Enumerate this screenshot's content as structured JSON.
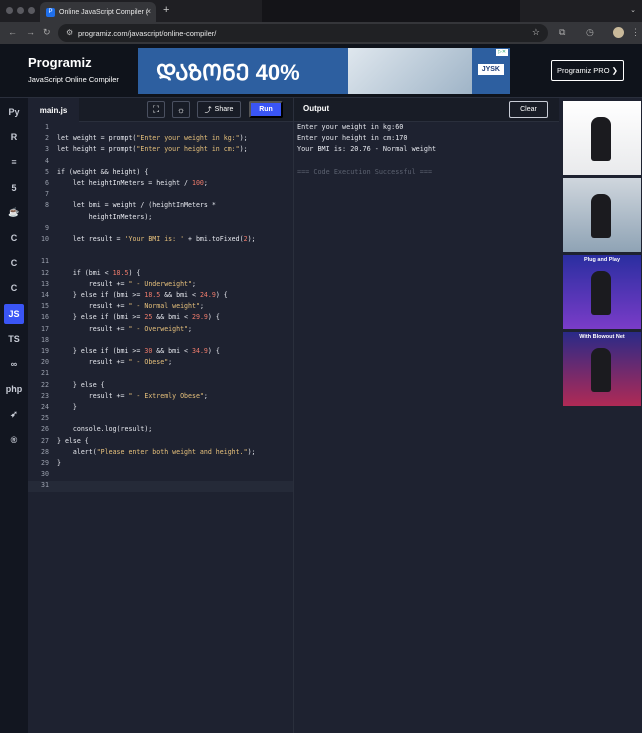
{
  "browser": {
    "tab_title": "Online JavaScript Compiler (",
    "tab_close": "×",
    "new_tab": "+",
    "url": "programiz.com/javascript/online-compiler/",
    "tabs_menu_icon": "chevron-down-icon"
  },
  "site": {
    "logo_text": "Programiz",
    "subtitle": "JavaScript Online Compiler",
    "pro_button": "Programiz PRO ❯"
  },
  "ad_banner": {
    "headline": "ᲓᲐᲖᲝᲜᲔ 40%",
    "brand": "JYSK"
  },
  "editor": {
    "file_tab": "main.js",
    "share_label": "Share",
    "run_label": "Run",
    "lines": [
      {
        "n": "1",
        "code": ""
      },
      {
        "n": "2",
        "code": "let weight = prompt(\"Enter your weight in kg:\");"
      },
      {
        "n": "3",
        "code": "let height = prompt(\"Enter your height in cm:\");"
      },
      {
        "n": "4",
        "code": ""
      },
      {
        "n": "5",
        "code": "if (weight && height) {"
      },
      {
        "n": "6",
        "code": "    let heightInMeters = height / 100;"
      },
      {
        "n": "7",
        "code": ""
      },
      {
        "n": "8",
        "code": "    let bmi = weight / (heightInMeters *"
      },
      {
        "n": "",
        "code": "        heightInMeters);"
      },
      {
        "n": "9",
        "code": ""
      },
      {
        "n": "10",
        "code": "    let result = 'Your BMI is: ' + bmi.toFixed(2);"
      },
      {
        "n": "",
        "code": ""
      },
      {
        "n": "11",
        "code": ""
      },
      {
        "n": "12",
        "code": "    if (bmi < 18.5) {"
      },
      {
        "n": "13",
        "code": "        result += \" - Underweight\";"
      },
      {
        "n": "14",
        "code": "    } else if (bmi >= 18.5 && bmi < 24.9) {"
      },
      {
        "n": "15",
        "code": "        result += \" - Normal weight\";"
      },
      {
        "n": "16",
        "code": "    } else if (bmi >= 25 && bmi < 29.9) {"
      },
      {
        "n": "17",
        "code": "        result += \" - Overweight\";"
      },
      {
        "n": "18",
        "code": ""
      },
      {
        "n": "19",
        "code": "    } else if (bmi >= 30 && bmi < 34.9) {"
      },
      {
        "n": "20",
        "code": "        result += \" - Obese\";"
      },
      {
        "n": "21",
        "code": ""
      },
      {
        "n": "22",
        "code": "    } else {"
      },
      {
        "n": "23",
        "code": "        result += \" - Extremly Obese\";"
      },
      {
        "n": "24",
        "code": "    }"
      },
      {
        "n": "25",
        "code": ""
      },
      {
        "n": "26",
        "code": "    console.log(result);"
      },
      {
        "n": "27",
        "code": "} else {"
      },
      {
        "n": "28",
        "code": "    alert(\"Please enter both weight and height.\");"
      },
      {
        "n": "29",
        "code": "}"
      },
      {
        "n": "30",
        "code": ""
      },
      {
        "n": "31",
        "code": ""
      }
    ]
  },
  "output": {
    "label": "Output",
    "clear_label": "Clear",
    "lines": [
      "Enter your weight in kg:60",
      "Enter your height in cm:170",
      "Your BMI is: 20.76 - Normal weight",
      "",
      "=== Code Execution Successful ==="
    ]
  },
  "side_ads": [
    {
      "caption": ""
    },
    {
      "caption": ""
    },
    {
      "caption": "Plug and Play"
    },
    {
      "caption": "With Blowout Net"
    }
  ],
  "sidebar_icons": [
    "python-icon",
    "r-icon",
    "sql-icon",
    "html-icon",
    "java-icon",
    "c-icon",
    "cpp-icon",
    "csharp-icon",
    "javascript-icon",
    "typescript-icon",
    "go-icon",
    "php-icon",
    "swift-icon",
    "rust-icon"
  ],
  "sidebar_labels": [
    "Py",
    "R",
    "≡",
    "5",
    "☕",
    "C",
    "C",
    "C",
    "JS",
    "TS",
    "∞",
    "php",
    "➶",
    "®"
  ],
  "colors": {
    "accent": "#3a55f5",
    "editor_bg": "#1e2230",
    "header_bg": "#0f131b"
  }
}
